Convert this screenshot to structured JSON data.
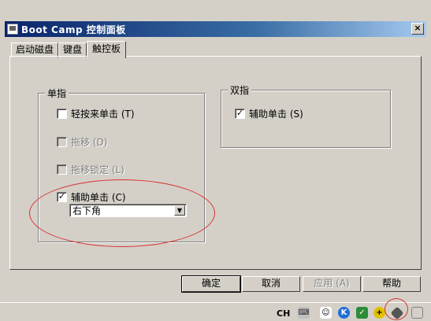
{
  "window": {
    "title": "Boot Camp 控制面板",
    "close_label": "×"
  },
  "tabs": [
    {
      "label": "启动磁盘",
      "active": false
    },
    {
      "label": "键盘",
      "active": false
    },
    {
      "label": "触控板",
      "active": true
    }
  ],
  "single_finger": {
    "title": "单指",
    "options": [
      {
        "label": "轻按来单击 (T)",
        "checked": false,
        "enabled": true
      },
      {
        "label": "拖移 (D)",
        "checked": false,
        "enabled": false
      },
      {
        "label": "拖移锁定 (L)",
        "checked": false,
        "enabled": false
      },
      {
        "label": "辅助单击 (C)",
        "checked": true,
        "enabled": true
      }
    ],
    "secondary_click_corner": "右下角"
  },
  "two_finger": {
    "title": "双指",
    "options": [
      {
        "label": "辅助单击 (S)",
        "checked": true,
        "enabled": true
      }
    ]
  },
  "buttons": {
    "ok": "确定",
    "cancel": "取消",
    "apply": "应用 (A)",
    "help": "帮助"
  },
  "taskbar": {
    "ime_label": "CH"
  },
  "colors": {
    "title_bar": "#0a246a",
    "annotation": "#d93030"
  }
}
